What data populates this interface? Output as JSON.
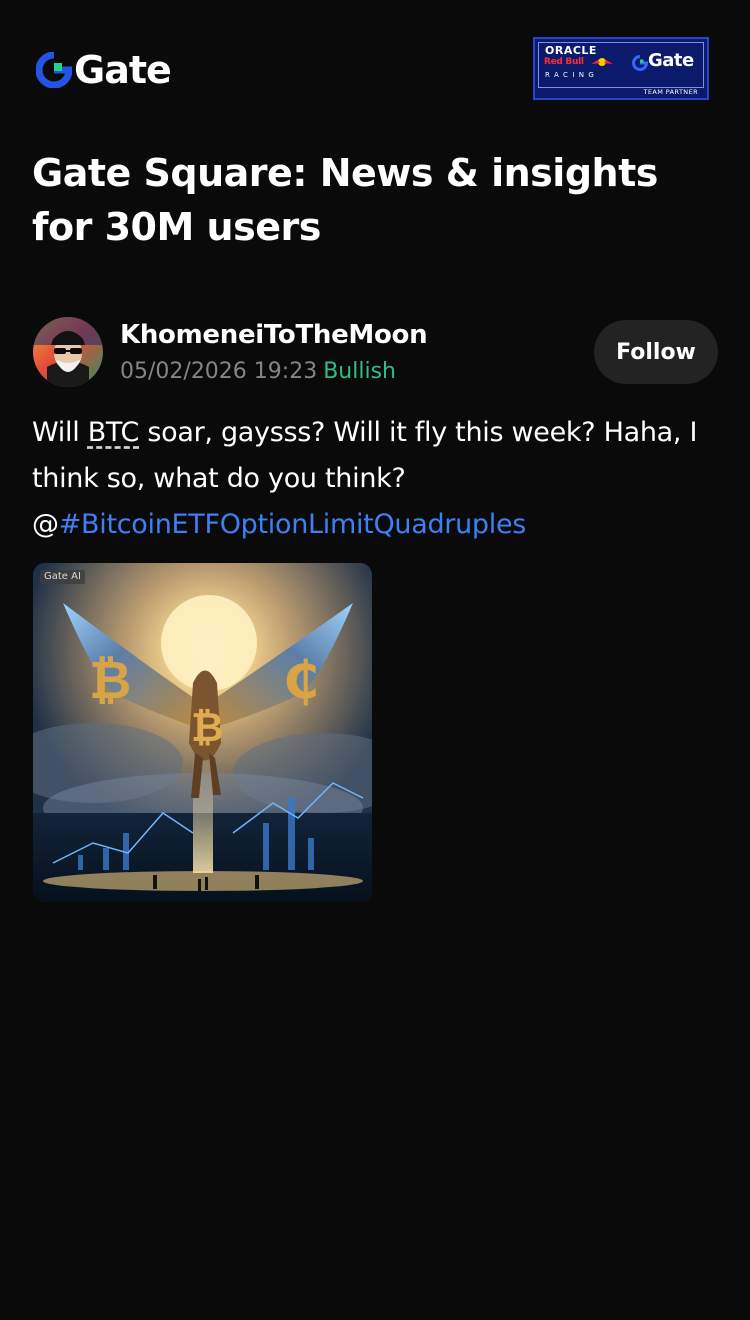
{
  "brand": {
    "logo_text": "Gate",
    "logo_icon": "gate-logo-icon",
    "partner_badge": {
      "oracle": "ORACLE",
      "redbull": "Red Bull",
      "racing": "RACING",
      "gate": "Gate",
      "team_partner": "TEAM PARTNER"
    }
  },
  "headline": "Gate Square: News & insights for 30M users",
  "post": {
    "author": "KhomeneiToTheMoon",
    "timestamp": "05/02/2026 19:23",
    "sentiment": "Bullish",
    "follow_label": "Follow",
    "text_part1": "Will ",
    "coin_tag": "BTC",
    "text_part2": " soar, gaysss? Will it fly this week? Haha, I think so, what do you think?",
    "mention_prefix": "@",
    "hashtag": "#BitcoinETFOptionLimitQuadruples",
    "image_tag": "Gate AI"
  },
  "colors": {
    "background": "#0a0a0a",
    "sentiment_green": "#2ebd85",
    "hashtag_blue": "#3d7ff5",
    "follow_button_bg": "#232323",
    "brand_blue": "#2354e6"
  }
}
